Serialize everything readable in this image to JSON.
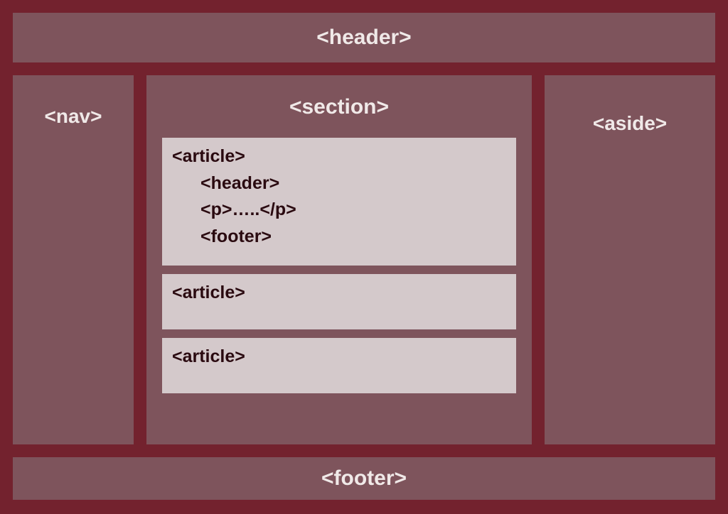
{
  "header": {
    "label": "<header>"
  },
  "nav": {
    "label": "<nav>"
  },
  "section": {
    "label": "<section>",
    "articles": [
      {
        "label": "<article>",
        "children": {
          "header": "<header>",
          "p": "<p>…..</p>",
          "footer": "<footer>"
        }
      },
      {
        "label": "<article>"
      },
      {
        "label": "<article>"
      }
    ]
  },
  "aside": {
    "label": "<aside>"
  },
  "footer": {
    "label": "<footer>"
  }
}
